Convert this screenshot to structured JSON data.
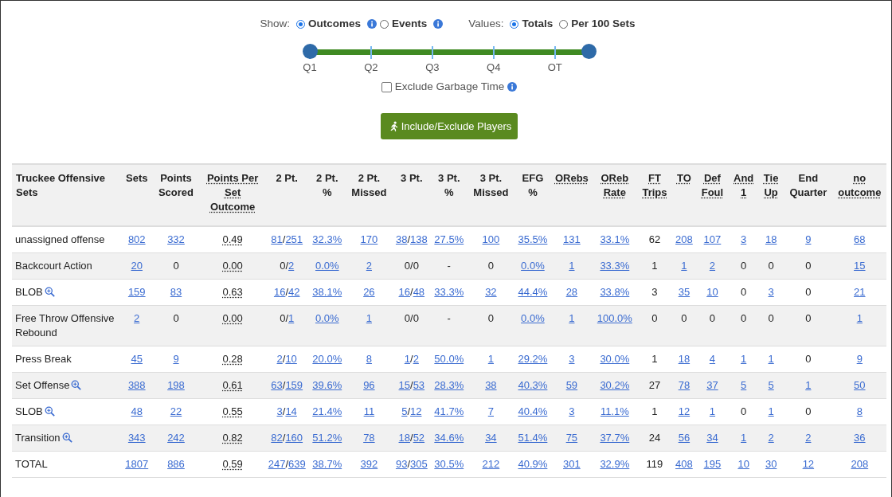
{
  "show": {
    "label": "Show:",
    "options": [
      {
        "label": "Outcomes",
        "selected": true,
        "info": true
      },
      {
        "label": "Events",
        "selected": false,
        "info": true
      }
    ]
  },
  "values": {
    "label": "Values:",
    "options": [
      {
        "label": "Totals",
        "selected": true
      },
      {
        "label": "Per 100 Sets",
        "selected": false
      }
    ]
  },
  "quarter_slider": {
    "stops": [
      "Q1",
      "Q2",
      "Q3",
      "Q4",
      "OT"
    ],
    "thumbs": [
      {
        "level": 0
      },
      {
        "level": 1
      }
    ]
  },
  "garbage_time": {
    "label": "Exclude Garbage Time",
    "checked": false,
    "info": true
  },
  "players_button": {
    "label": "Include/Exclude Players"
  },
  "table": {
    "columns": [
      {
        "label": "Truckee Offensive Sets",
        "hint": false,
        "values_hint": false
      },
      {
        "label": "Sets",
        "hint": false,
        "values_hint": false
      },
      {
        "label": "Points Scored",
        "hint": false,
        "values_hint": false
      },
      {
        "label": "Points Per Set Outcome",
        "hint": true,
        "values_hint": true
      },
      {
        "label": "2 Pt.",
        "hint": false,
        "values_hint": false
      },
      {
        "label": "2 Pt. %",
        "hint": false,
        "values_hint": false
      },
      {
        "label": "2 Pt. Missed",
        "hint": false,
        "values_hint": false
      },
      {
        "label": "3 Pt.",
        "hint": false,
        "values_hint": false
      },
      {
        "label": "3 Pt. %",
        "hint": false,
        "values_hint": false
      },
      {
        "label": "3 Pt. Missed",
        "hint": false,
        "values_hint": false
      },
      {
        "label": "EFG %",
        "hint": false,
        "values_hint": false
      },
      {
        "label": "ORebs",
        "hint": true,
        "values_hint": false
      },
      {
        "label": "OReb Rate",
        "hint": true,
        "values_hint": false
      },
      {
        "label": "FT Trips",
        "hint": true,
        "values_hint": false
      },
      {
        "label": "TO",
        "hint": true,
        "values_hint": false
      },
      {
        "label": "Def Foul",
        "hint": true,
        "values_hint": false
      },
      {
        "label": "And 1",
        "hint": true,
        "values_hint": false
      },
      {
        "label": "Tie Up",
        "hint": true,
        "values_hint": false
      },
      {
        "label": "End Quarter",
        "hint": false,
        "values_hint": false
      },
      {
        "label": "no outcome",
        "hint": true,
        "values_hint": false
      }
    ],
    "rows": [
      {
        "cells": [
          {
            "text": "unassigned offense",
            "link": false,
            "zoom": false
          },
          {
            "text": "802",
            "link": true
          },
          {
            "text": "332",
            "link": true
          },
          {
            "text": "0.49",
            "link": false
          },
          {
            "segments": [
              {
                "text": "81",
                "link": true
              },
              {
                "text": "/",
                "link": false
              },
              {
                "text": "251",
                "link": true
              }
            ]
          },
          {
            "text": "32.3%",
            "link": true
          },
          {
            "text": "170",
            "link": true
          },
          {
            "segments": [
              {
                "text": "38",
                "link": true
              },
              {
                "text": "/",
                "link": false
              },
              {
                "text": "138",
                "link": true
              }
            ]
          },
          {
            "text": "27.5%",
            "link": true
          },
          {
            "text": "100",
            "link": true
          },
          {
            "text": "35.5%",
            "link": true
          },
          {
            "text": "131",
            "link": true
          },
          {
            "text": "33.1%",
            "link": true
          },
          {
            "text": "62",
            "link": false
          },
          {
            "text": "208",
            "link": true
          },
          {
            "text": "107",
            "link": true
          },
          {
            "text": "3",
            "link": true
          },
          {
            "text": "18",
            "link": true
          },
          {
            "text": "9",
            "link": true
          },
          {
            "text": "68",
            "link": true
          }
        ]
      },
      {
        "cells": [
          {
            "text": "Backcourt Action",
            "link": false,
            "zoom": false
          },
          {
            "text": "20",
            "link": true
          },
          {
            "text": "0",
            "link": false
          },
          {
            "text": "0.00",
            "link": false
          },
          {
            "segments": [
              {
                "text": "0",
                "link": false
              },
              {
                "text": "/",
                "link": false
              },
              {
                "text": "2",
                "link": true
              }
            ]
          },
          {
            "text": "0.0%",
            "link": true
          },
          {
            "text": "2",
            "link": true
          },
          {
            "segments": [
              {
                "text": "0",
                "link": false
              },
              {
                "text": "/",
                "link": false
              },
              {
                "text": "0",
                "link": false
              }
            ]
          },
          {
            "text": "-",
            "link": false
          },
          {
            "text": "0",
            "link": false
          },
          {
            "text": "0.0%",
            "link": true
          },
          {
            "text": "1",
            "link": true
          },
          {
            "text": "33.3%",
            "link": true
          },
          {
            "text": "1",
            "link": false
          },
          {
            "text": "1",
            "link": true
          },
          {
            "text": "2",
            "link": true
          },
          {
            "text": "0",
            "link": false
          },
          {
            "text": "0",
            "link": false
          },
          {
            "text": "0",
            "link": false
          },
          {
            "text": "15",
            "link": true
          }
        ]
      },
      {
        "cells": [
          {
            "text": "BLOB",
            "link": false,
            "zoom": true
          },
          {
            "text": "159",
            "link": true
          },
          {
            "text": "83",
            "link": true
          },
          {
            "text": "0.63",
            "link": false
          },
          {
            "segments": [
              {
                "text": "16",
                "link": true
              },
              {
                "text": "/",
                "link": false
              },
              {
                "text": "42",
                "link": true
              }
            ]
          },
          {
            "text": "38.1%",
            "link": true
          },
          {
            "text": "26",
            "link": true
          },
          {
            "segments": [
              {
                "text": "16",
                "link": true
              },
              {
                "text": "/",
                "link": false
              },
              {
                "text": "48",
                "link": true
              }
            ]
          },
          {
            "text": "33.3%",
            "link": true
          },
          {
            "text": "32",
            "link": true
          },
          {
            "text": "44.4%",
            "link": true
          },
          {
            "text": "28",
            "link": true
          },
          {
            "text": "33.8%",
            "link": true
          },
          {
            "text": "3",
            "link": false
          },
          {
            "text": "35",
            "link": true
          },
          {
            "text": "10",
            "link": true
          },
          {
            "text": "0",
            "link": false
          },
          {
            "text": "3",
            "link": true
          },
          {
            "text": "0",
            "link": false
          },
          {
            "text": "21",
            "link": true
          }
        ]
      },
      {
        "cells": [
          {
            "text": "Free Throw Offensive Rebound",
            "link": false,
            "zoom": false
          },
          {
            "text": "2",
            "link": true
          },
          {
            "text": "0",
            "link": false
          },
          {
            "text": "0.00",
            "link": false
          },
          {
            "segments": [
              {
                "text": "0",
                "link": false
              },
              {
                "text": "/",
                "link": false
              },
              {
                "text": "1",
                "link": true
              }
            ]
          },
          {
            "text": "0.0%",
            "link": true
          },
          {
            "text": "1",
            "link": true
          },
          {
            "segments": [
              {
                "text": "0",
                "link": false
              },
              {
                "text": "/",
                "link": false
              },
              {
                "text": "0",
                "link": false
              }
            ]
          },
          {
            "text": "-",
            "link": false
          },
          {
            "text": "0",
            "link": false
          },
          {
            "text": "0.0%",
            "link": true
          },
          {
            "text": "1",
            "link": true
          },
          {
            "text": "100.0%",
            "link": true
          },
          {
            "text": "0",
            "link": false
          },
          {
            "text": "0",
            "link": false
          },
          {
            "text": "0",
            "link": false
          },
          {
            "text": "0",
            "link": false
          },
          {
            "text": "0",
            "link": false
          },
          {
            "text": "0",
            "link": false
          },
          {
            "text": "1",
            "link": true
          }
        ]
      },
      {
        "cells": [
          {
            "text": "Press Break",
            "link": false,
            "zoom": false
          },
          {
            "text": "45",
            "link": true
          },
          {
            "text": "9",
            "link": true
          },
          {
            "text": "0.28",
            "link": false
          },
          {
            "segments": [
              {
                "text": "2",
                "link": true
              },
              {
                "text": "/",
                "link": false
              },
              {
                "text": "10",
                "link": true
              }
            ]
          },
          {
            "text": "20.0%",
            "link": true
          },
          {
            "text": "8",
            "link": true
          },
          {
            "segments": [
              {
                "text": "1",
                "link": true
              },
              {
                "text": "/",
                "link": false
              },
              {
                "text": "2",
                "link": true
              }
            ]
          },
          {
            "text": "50.0%",
            "link": true
          },
          {
            "text": "1",
            "link": true
          },
          {
            "text": "29.2%",
            "link": true
          },
          {
            "text": "3",
            "link": true
          },
          {
            "text": "30.0%",
            "link": true
          },
          {
            "text": "1",
            "link": false
          },
          {
            "text": "18",
            "link": true
          },
          {
            "text": "4",
            "link": true
          },
          {
            "text": "1",
            "link": true
          },
          {
            "text": "1",
            "link": true
          },
          {
            "text": "0",
            "link": false
          },
          {
            "text": "9",
            "link": true
          }
        ]
      },
      {
        "cells": [
          {
            "text": "Set Offense",
            "link": false,
            "zoom": true
          },
          {
            "text": "388",
            "link": true
          },
          {
            "text": "198",
            "link": true
          },
          {
            "text": "0.61",
            "link": false
          },
          {
            "segments": [
              {
                "text": "63",
                "link": true
              },
              {
                "text": "/",
                "link": false
              },
              {
                "text": "159",
                "link": true
              }
            ]
          },
          {
            "text": "39.6%",
            "link": true
          },
          {
            "text": "96",
            "link": true
          },
          {
            "segments": [
              {
                "text": "15",
                "link": true
              },
              {
                "text": "/",
                "link": false
              },
              {
                "text": "53",
                "link": true
              }
            ]
          },
          {
            "text": "28.3%",
            "link": true
          },
          {
            "text": "38",
            "link": true
          },
          {
            "text": "40.3%",
            "link": true
          },
          {
            "text": "59",
            "link": true
          },
          {
            "text": "30.2%",
            "link": true
          },
          {
            "text": "27",
            "link": false
          },
          {
            "text": "78",
            "link": true
          },
          {
            "text": "37",
            "link": true
          },
          {
            "text": "5",
            "link": true
          },
          {
            "text": "5",
            "link": true
          },
          {
            "text": "1",
            "link": true
          },
          {
            "text": "50",
            "link": true
          }
        ]
      },
      {
        "cells": [
          {
            "text": "SLOB",
            "link": false,
            "zoom": true
          },
          {
            "text": "48",
            "link": true
          },
          {
            "text": "22",
            "link": true
          },
          {
            "text": "0.55",
            "link": false
          },
          {
            "segments": [
              {
                "text": "3",
                "link": true
              },
              {
                "text": "/",
                "link": false
              },
              {
                "text": "14",
                "link": true
              }
            ]
          },
          {
            "text": "21.4%",
            "link": true
          },
          {
            "text": "11",
            "link": true
          },
          {
            "segments": [
              {
                "text": "5",
                "link": true
              },
              {
                "text": "/",
                "link": false
              },
              {
                "text": "12",
                "link": true
              }
            ]
          },
          {
            "text": "41.7%",
            "link": true
          },
          {
            "text": "7",
            "link": true
          },
          {
            "text": "40.4%",
            "link": true
          },
          {
            "text": "3",
            "link": true
          },
          {
            "text": "11.1%",
            "link": true
          },
          {
            "text": "1",
            "link": false
          },
          {
            "text": "12",
            "link": true
          },
          {
            "text": "1",
            "link": true
          },
          {
            "text": "0",
            "link": false
          },
          {
            "text": "1",
            "link": true
          },
          {
            "text": "0",
            "link": false
          },
          {
            "text": "8",
            "link": true
          }
        ]
      },
      {
        "cells": [
          {
            "text": "Transition",
            "link": false,
            "zoom": true
          },
          {
            "text": "343",
            "link": true
          },
          {
            "text": "242",
            "link": true
          },
          {
            "text": "0.82",
            "link": false
          },
          {
            "segments": [
              {
                "text": "82",
                "link": true
              },
              {
                "text": "/",
                "link": false
              },
              {
                "text": "160",
                "link": true
              }
            ]
          },
          {
            "text": "51.2%",
            "link": true
          },
          {
            "text": "78",
            "link": true
          },
          {
            "segments": [
              {
                "text": "18",
                "link": true
              },
              {
                "text": "/",
                "link": false
              },
              {
                "text": "52",
                "link": true
              }
            ]
          },
          {
            "text": "34.6%",
            "link": true
          },
          {
            "text": "34",
            "link": true
          },
          {
            "text": "51.4%",
            "link": true
          },
          {
            "text": "75",
            "link": true
          },
          {
            "text": "37.7%",
            "link": true
          },
          {
            "text": "24",
            "link": false
          },
          {
            "text": "56",
            "link": true
          },
          {
            "text": "34",
            "link": true
          },
          {
            "text": "1",
            "link": true
          },
          {
            "text": "2",
            "link": true
          },
          {
            "text": "2",
            "link": true
          },
          {
            "text": "36",
            "link": true
          }
        ]
      },
      {
        "cells": [
          {
            "text": "TOTAL",
            "link": false,
            "zoom": false
          },
          {
            "text": "1807",
            "link": true
          },
          {
            "text": "886",
            "link": true
          },
          {
            "text": "0.59",
            "link": false
          },
          {
            "segments": [
              {
                "text": "247",
                "link": true
              },
              {
                "text": "/",
                "link": false
              },
              {
                "text": "639",
                "link": true
              }
            ]
          },
          {
            "text": "38.7%",
            "link": true
          },
          {
            "text": "392",
            "link": true
          },
          {
            "segments": [
              {
                "text": "93",
                "link": true
              },
              {
                "text": "/",
                "link": false
              },
              {
                "text": "305",
                "link": true
              }
            ]
          },
          {
            "text": "30.5%",
            "link": true
          },
          {
            "text": "212",
            "link": true
          },
          {
            "text": "40.9%",
            "link": true
          },
          {
            "text": "301",
            "link": true
          },
          {
            "text": "32.9%",
            "link": true
          },
          {
            "text": "119",
            "link": false
          },
          {
            "text": "408",
            "link": true
          },
          {
            "text": "195",
            "link": true
          },
          {
            "text": "10",
            "link": true
          },
          {
            "text": "30",
            "link": true
          },
          {
            "text": "12",
            "link": true
          },
          {
            "text": "208",
            "link": true
          }
        ]
      }
    ]
  }
}
